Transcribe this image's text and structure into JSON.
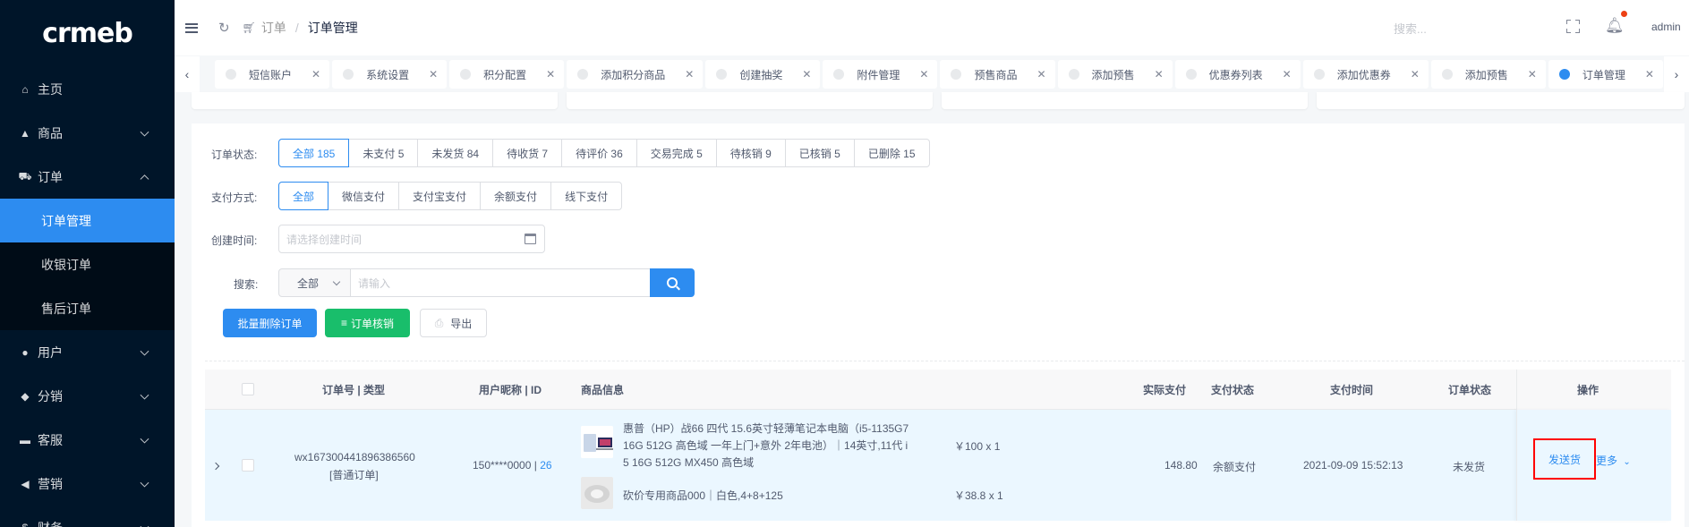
{
  "sidebar": {
    "logo": "crmeb",
    "menu": [
      {
        "label": "主页",
        "icon": "home-icon",
        "glyph": "⌂"
      },
      {
        "label": "商品",
        "icon": "basket-icon",
        "glyph": "▲"
      },
      {
        "label": "订单",
        "icon": "cart-icon",
        "glyph": "⛟"
      },
      {
        "label": "用户",
        "icon": "user-icon",
        "glyph": "●"
      },
      {
        "label": "分销",
        "icon": "distribution-icon",
        "glyph": "◆"
      },
      {
        "label": "客服",
        "icon": "chat-icon",
        "glyph": "▬"
      },
      {
        "label": "营销",
        "icon": "send-icon",
        "glyph": "◀"
      },
      {
        "label": "财务",
        "icon": "dollar-icon",
        "glyph": "$"
      }
    ],
    "order_sub": [
      "订单管理",
      "收银订单",
      "售后订单"
    ]
  },
  "header": {
    "breadcrumb_1": "订单",
    "breadcrumb_sep": "/",
    "breadcrumb_2": "订单管理",
    "search_placeholder": "搜索...",
    "user": "admin"
  },
  "tabs": [
    "短信账户",
    "系统设置",
    "积分配置",
    "添加积分商品",
    "创建抽奖",
    "附件管理",
    "预售商品",
    "添加预售",
    "优惠券列表",
    "添加优惠券",
    "添加预售",
    "订单管理"
  ],
  "filters": {
    "status_label": "订单状态:",
    "status_options": [
      "全部 185",
      "未支付 5",
      "未发货 84",
      "待收货 7",
      "待评价 36",
      "交易完成 5",
      "待核销 9",
      "已核销 5",
      "已删除 15"
    ],
    "pay_label": "支付方式:",
    "pay_options": [
      "全部",
      "微信支付",
      "支付宝支付",
      "余额支付",
      "线下支付"
    ],
    "time_label": "创建时间:",
    "time_placeholder": "请选择创建时间",
    "search_label": "搜索:",
    "search_select": "全部",
    "search_placeholder": "请输入"
  },
  "actions": {
    "batch_delete": "批量删除订单",
    "verify": "订单核销",
    "export": "导出"
  },
  "table": {
    "headers": [
      "订单号 | 类型",
      "用户昵称 | ID",
      "商品信息",
      "实际支付",
      "支付状态",
      "支付时间",
      "订单状态",
      "操作"
    ],
    "row": {
      "order_no": "wx167300441896386560",
      "order_type": "[普通订单]",
      "user_nick": "150****0000 | ",
      "user_id": "26",
      "product1_line1": "惠普（HP）战66 四代 15.6英寸轻薄笔记本电脑（i5-1135G7",
      "product1_line2": "16G 512G 高色域 一年上门+意外 2年电池）｜14英寸,11代 i",
      "product1_line3": "5 16G 512G MX450 高色域",
      "product1_price": "￥100 x 1",
      "product2_name": "砍价专用商品000｜白色,4+8+125",
      "product2_price": "￥38.8 x 1",
      "paid": "148.80",
      "pay_status": "余额支付",
      "pay_time": "2021-09-09 15:52:13",
      "order_status": "未发货",
      "ship": "发送货",
      "more": "更多"
    }
  }
}
